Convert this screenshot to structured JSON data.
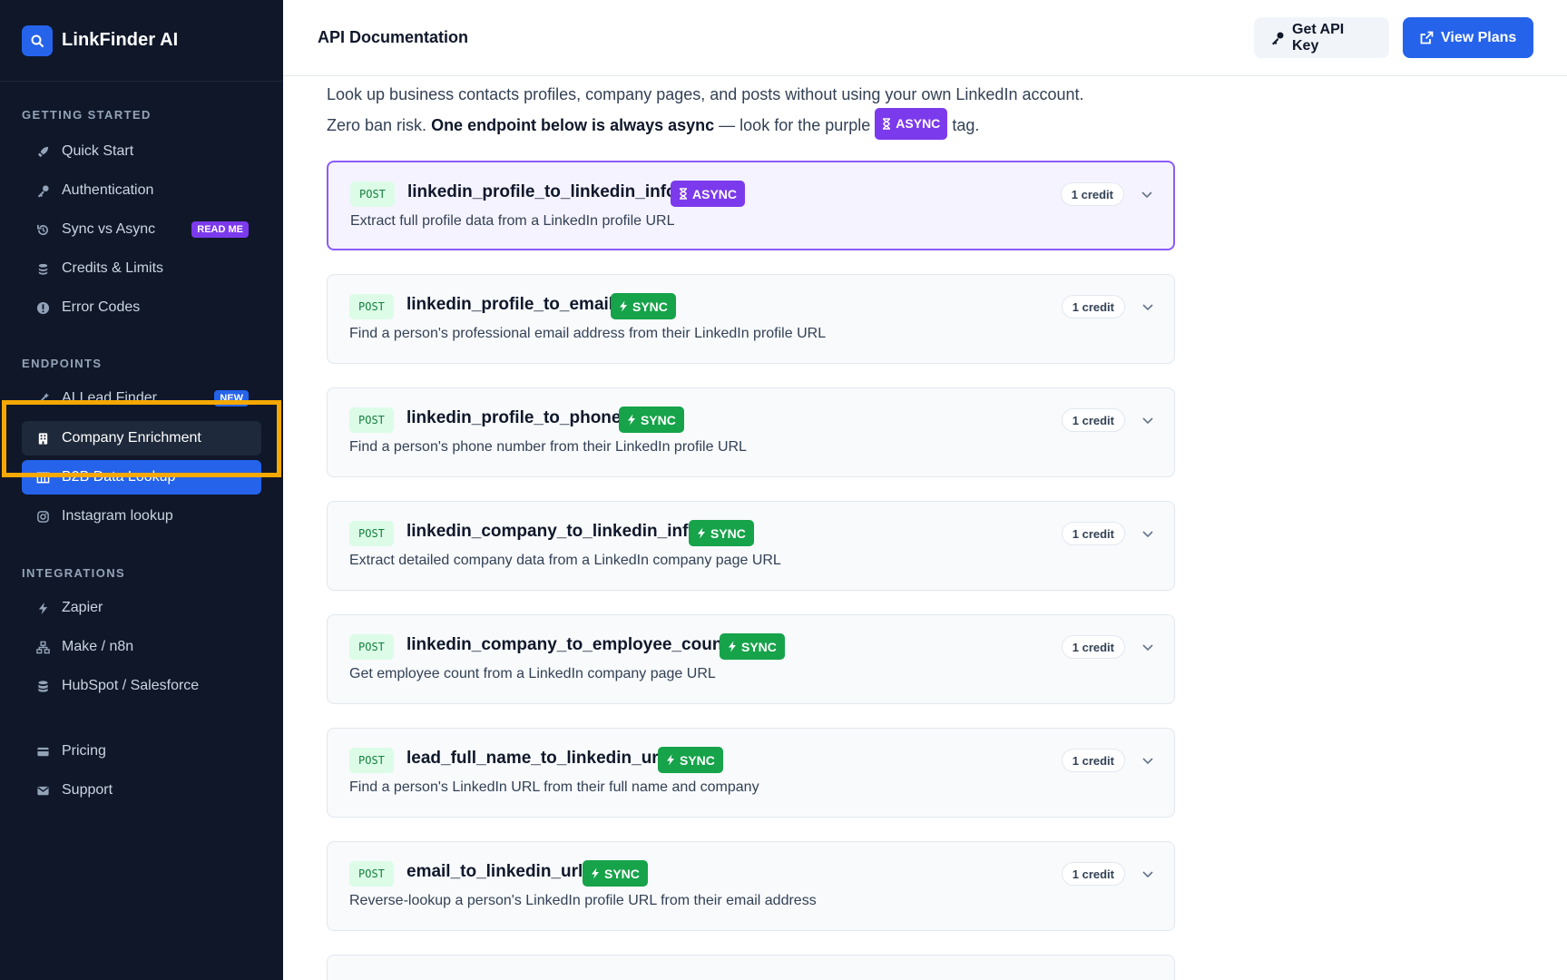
{
  "brand": {
    "name": "LinkFinder AI"
  },
  "sidebar": {
    "sections": [
      {
        "title": "GETTING STARTED"
      },
      {
        "title": "ENDPOINTS"
      },
      {
        "title": "INTEGRATIONS"
      }
    ],
    "items": [
      {
        "label": "Quick Start",
        "icon": "rocket-icon"
      },
      {
        "label": "Authentication",
        "icon": "key-icon"
      },
      {
        "label": "Sync vs Async",
        "icon": "history-icon",
        "badge": "READ ME"
      },
      {
        "label": "Credits & Limits",
        "icon": "coins-icon"
      },
      {
        "label": "Error Codes",
        "icon": "alert-icon"
      },
      {
        "label": "AI Lead Finder",
        "icon": "wand-icon",
        "badge": "NEW"
      },
      {
        "label": "Company Enrichment",
        "icon": "building-icon"
      },
      {
        "label": "B2B Data Lookup",
        "icon": "table-icon"
      },
      {
        "label": "Instagram lookup",
        "icon": "instagram-icon"
      },
      {
        "label": "Zapier",
        "icon": "bolt-icon"
      },
      {
        "label": "Make / n8n",
        "icon": "network-icon"
      },
      {
        "label": "HubSpot / Salesforce",
        "icon": "database-icon"
      },
      {
        "label": "Pricing",
        "icon": "credit-card-icon"
      },
      {
        "label": "Support",
        "icon": "envelope-icon"
      }
    ]
  },
  "header": {
    "title": "API Documentation",
    "get_key_label": "Get API Key",
    "view_plans_label": "View Plans"
  },
  "intro": {
    "line1": "Look up business contacts profiles, company pages, and posts without using your own LinkedIn account.",
    "line2_start": "Zero ban risk.",
    "line2_bold": "One endpoint below is always async",
    "line2_mid": "— look for the purple",
    "tag": "ASYNC",
    "line2_end": "tag."
  },
  "endpoints": [
    {
      "method": "POST",
      "name": "linkedin_profile_to_linkedin_info",
      "mode": "ASYNC",
      "description": "Extract full profile data from a LinkedIn profile URL",
      "credit": "1 credit"
    },
    {
      "method": "POST",
      "name": "linkedin_profile_to_email",
      "mode": "SYNC",
      "description": "Find a person's professional email address from their LinkedIn profile URL",
      "credit": "1 credit"
    },
    {
      "method": "POST",
      "name": "linkedin_profile_to_phone",
      "mode": "SYNC",
      "description": "Find a person's phone number from their LinkedIn profile URL",
      "credit": "1 credit"
    },
    {
      "method": "POST",
      "name": "linkedin_company_to_linkedin_info",
      "mode": "SYNC",
      "description": "Extract detailed company data from a LinkedIn company page URL",
      "credit": "1 credit"
    },
    {
      "method": "POST",
      "name": "linkedin_company_to_employee_count",
      "mode": "SYNC",
      "description": "Get employee count from a LinkedIn company page URL",
      "credit": "1 credit"
    },
    {
      "method": "POST",
      "name": "lead_full_name_to_linkedin_url",
      "mode": "SYNC",
      "description": "Find a person's LinkedIn URL from their full name and company",
      "credit": "1 credit"
    },
    {
      "method": "POST",
      "name": "email_to_linkedin_url",
      "mode": "SYNC",
      "description": "Reverse-lookup a person's LinkedIn profile URL from their email address",
      "credit": "1 credit"
    }
  ],
  "colors": {
    "sidebar_bg": "#0f1729",
    "accent": "#2563eb",
    "async": "#7c3aed",
    "sync": "#16a34a",
    "highlight": "#f5a800"
  }
}
